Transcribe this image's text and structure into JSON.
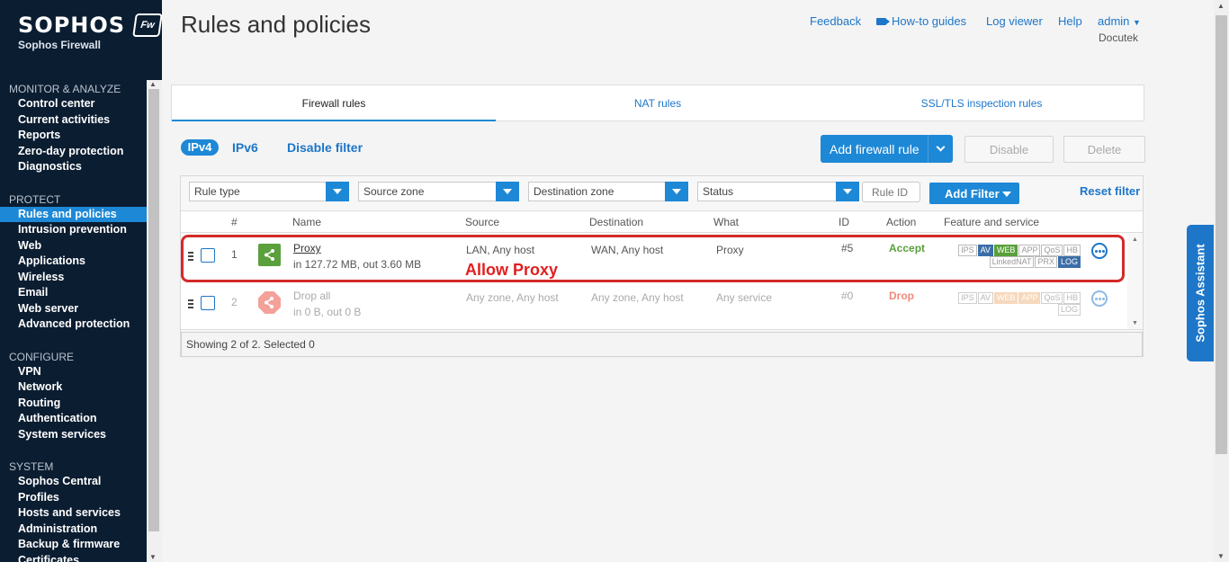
{
  "brand": {
    "logo": "SOPHOS",
    "badge": "Fw",
    "product": "Sophos Firewall"
  },
  "sidebar": {
    "sections": [
      {
        "title": "MONITOR & ANALYZE",
        "items": [
          "Control center",
          "Current activities",
          "Reports",
          "Zero-day protection",
          "Diagnostics"
        ]
      },
      {
        "title": "PROTECT",
        "items": [
          "Rules and policies",
          "Intrusion prevention",
          "Web",
          "Applications",
          "Wireless",
          "Email",
          "Web server",
          "Advanced protection"
        ]
      },
      {
        "title": "CONFIGURE",
        "items": [
          "VPN",
          "Network",
          "Routing",
          "Authentication",
          "System services"
        ]
      },
      {
        "title": "SYSTEM",
        "items": [
          "Sophos Central",
          "Profiles",
          "Hosts and services",
          "Administration",
          "Backup & firmware",
          "Certificates"
        ]
      }
    ],
    "active_item": "Rules and policies"
  },
  "header": {
    "title": "Rules and policies",
    "links": {
      "feedback": "Feedback",
      "howto": "How-to guides",
      "log_viewer": "Log viewer",
      "help": "Help",
      "admin": "admin"
    },
    "org": "Docutek"
  },
  "tabs": {
    "firewall": "Firewall rules",
    "nat": "NAT rules",
    "ssl": "SSL/TLS inspection rules",
    "active": "Firewall rules"
  },
  "toolbar": {
    "ipv4": "IPv4",
    "ipv6": "IPv6",
    "disable_filter": "Disable filter",
    "add_rule": "Add firewall rule",
    "disable": "Disable",
    "delete": "Delete"
  },
  "filters": {
    "rule_type": "Rule type",
    "source_zone": "Source zone",
    "destination_zone": "Destination zone",
    "status": "Status",
    "rule_id_placeholder": "Rule ID",
    "add_filter": "Add Filter",
    "reset": "Reset filter"
  },
  "table": {
    "columns": {
      "num": "#",
      "name": "Name",
      "source": "Source",
      "destination": "Destination",
      "what": "What",
      "id": "ID",
      "action": "Action",
      "feature": "Feature and service"
    },
    "rows": [
      {
        "num": "1",
        "name": "Proxy",
        "traffic": "in 127.72 MB, out 3.60 MB",
        "source": "LAN, Any host",
        "destination": "WAN, Any host",
        "what": "Proxy",
        "id": "#5",
        "action": "Accept",
        "color": "#5aa03c"
      },
      {
        "num": "2",
        "name": "Drop all",
        "traffic": "in 0 B, out 0 B",
        "source": "Any zone, Any host",
        "destination": "Any zone, Any host",
        "what": "Any service",
        "id": "#0",
        "action": "Drop",
        "color": "#f4a19a"
      }
    ],
    "badges": {
      "ips": "IPS",
      "av": "AV",
      "web": "WEB",
      "app": "APP",
      "qos": "QoS",
      "hb": "HB",
      "linkednat": "LinkedNAT",
      "prx": "PRX",
      "log": "LOG"
    },
    "footer": "Showing 2 of 2. Selected 0"
  },
  "annotation": "Allow Proxy",
  "assistant": "Sophos Assistant"
}
